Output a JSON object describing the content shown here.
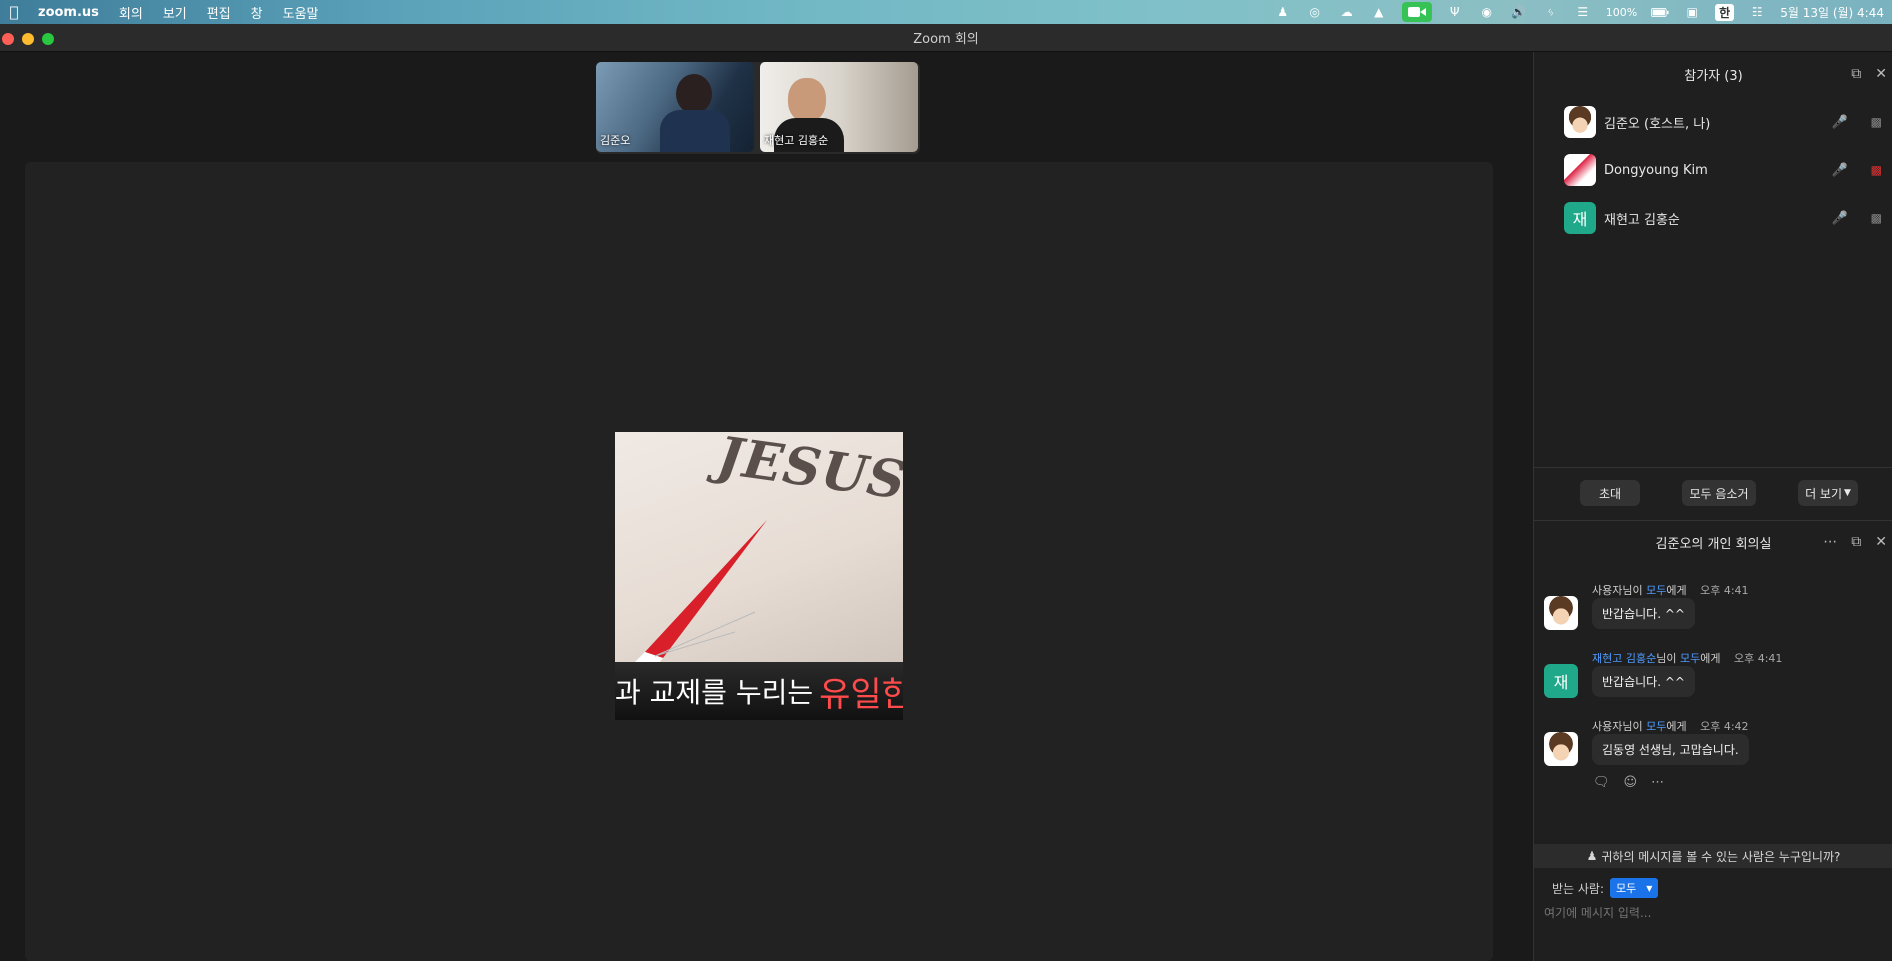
{
  "menubar": {
    "app_name": "zoom.us",
    "menus": [
      "회의",
      "보기",
      "편집",
      "창",
      "도움말"
    ],
    "battery": "100%",
    "input_source": "한",
    "datetime": "5월 13일 (월) 4:44"
  },
  "window": {
    "title": "Zoom 회의"
  },
  "thumbnails": [
    {
      "name": "김준오"
    },
    {
      "name": "재현고 김홍순"
    }
  ],
  "shared_screen": {
    "image_text": "JESUS",
    "caption_white": "과 교제를 누리는",
    "caption_red": "유일한"
  },
  "participants": {
    "title": "참가자 (3)",
    "list": [
      {
        "name": "김준오 (호스트, 나)",
        "avatar": "face",
        "video_off": false
      },
      {
        "name": "Dongyoung Kim",
        "avatar": "image",
        "video_off": true
      },
      {
        "name": "재현고 김홍순",
        "avatar": "재",
        "video_off": false
      }
    ],
    "buttons": {
      "invite": "초대",
      "mute_all": "모두 음소거",
      "more": "더 보기"
    }
  },
  "chat": {
    "title": "김준오의 개인 회의실",
    "messages": [
      {
        "sender": "사용자님이",
        "to": "모두",
        "to_suffix": "에게",
        "time": "오후 4:41",
        "text": "반갑습니다. ^^",
        "avatar": "face"
      },
      {
        "sender": "재현고 김홍순",
        "sender_suffix": "님이",
        "to": "모두",
        "to_suffix": "에게",
        "time": "오후 4:41",
        "text": "반갑습니다. ^^",
        "avatar": "재"
      },
      {
        "sender": "사용자님이",
        "to": "모두",
        "to_suffix": "에게",
        "time": "오후 4:42",
        "text": "김동영 선생님, 고맙습니다.",
        "avatar": "face"
      }
    ],
    "visibility_notice": "귀하의 메시지를 볼 수 있는 사람은 누구입니까?",
    "recipient_label": "받는 사람:",
    "recipient_value": "모두",
    "input_placeholder": "여기에 메시지 입력..."
  }
}
